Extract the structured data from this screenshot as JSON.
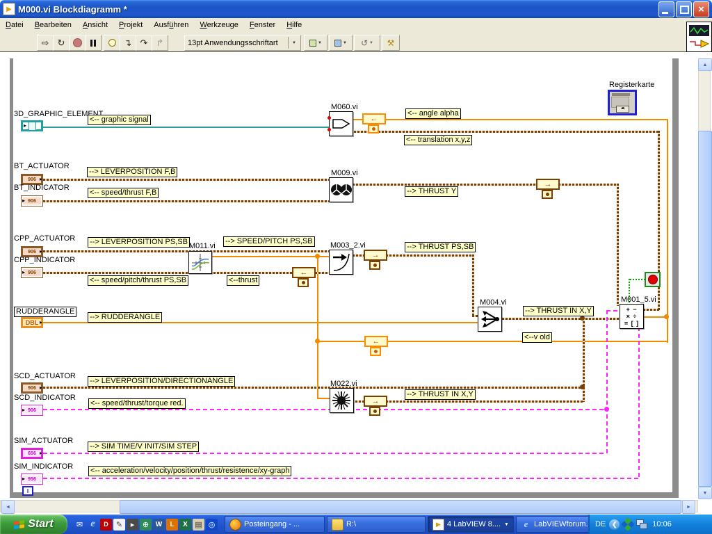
{
  "window": {
    "title": "M000.vi Blockdiagramm *",
    "close_glyph": "×"
  },
  "menu": {
    "items": [
      {
        "pre": "",
        "key": "D",
        "post": "atei"
      },
      {
        "pre": "",
        "key": "B",
        "post": "earbeiten"
      },
      {
        "pre": "",
        "key": "A",
        "post": "nsicht"
      },
      {
        "pre": "",
        "key": "P",
        "post": "rojekt"
      },
      {
        "pre": "Ausf",
        "key": "ü",
        "post": "hren"
      },
      {
        "pre": "",
        "key": "W",
        "post": "erkzeuge"
      },
      {
        "pre": "",
        "key": "F",
        "post": "enster"
      },
      {
        "pre": "",
        "key": "H",
        "post": "ilfe"
      }
    ]
  },
  "toolbar": {
    "font_selector": "13pt Anwendungsschriftart",
    "icons": {
      "run": "⇨",
      "run_continuous": "↻",
      "step_into": "↴",
      "step_over": "↷",
      "step_out": "↱",
      "dropdown": "▼",
      "help": "?"
    }
  },
  "diagram": {
    "terminals": {
      "g3d": {
        "name": "3D_GRAPHIC_ELEMENT"
      },
      "bt_actuator": {
        "name": "BT_ACTUATOR",
        "glyph": "906"
      },
      "bt_indicator": {
        "name": "BT_INDICATOR",
        "glyph": "906"
      },
      "cpp_actuator": {
        "name": "CPP_ACTUATOR",
        "glyph": "906"
      },
      "cpp_indicator": {
        "name": "CPP_INDICATOR",
        "glyph": "906"
      },
      "rudderangle": {
        "name": "RUDDERANGLE",
        "glyph": "DBL"
      },
      "scd_actuator": {
        "name": "SCD_ACTUATOR",
        "glyph": "906"
      },
      "scd_indicator": {
        "name": "SCD_INDICATOR",
        "glyph": "906"
      },
      "sim_actuator": {
        "name": "SIM_ACTUATOR",
        "glyph": "656"
      },
      "sim_indicator": {
        "name": "SIM_INDICATOR",
        "glyph": "956"
      },
      "sim_indicator2": {
        "glyph": "I"
      },
      "registerkarte": {
        "name": "Registerkarte",
        "chip": "◂▸"
      }
    },
    "vis": {
      "m060": "M060.vi",
      "m009": "M009.vi",
      "m011": "M011.vi",
      "m003_2": "M003_2.vi",
      "m004": "M004.vi",
      "m022": "M022.vi",
      "m001_5": "M001_5.vi",
      "m001_rows": [
        "+ −",
        "× ÷",
        "= [ ]"
      ]
    },
    "wire_labels": {
      "graphic_signal": "<-- graphic signal",
      "angle_alpha": "<-- angle alpha",
      "translation": "<-- translation x,y,z",
      "lever_fb": "--> LEVERPOSITION F,B",
      "speed_thrust_fb": "<-- speed/thrust F,B",
      "thrust_y": "--> THRUST Y",
      "lever_pssb": "--> LEVERPOSITION PS,SB",
      "speed_pitch_pssb": "--> SPEED/PITCH PS,SB",
      "thrust_pssb": "--> THRUST PS,SB",
      "speed_pitch_thrust_pssb": "<-- speed/pitch/thrust PS,SB",
      "thrust_small": "<--thrust",
      "rudderangle": "--> RUDDERANGLE",
      "thrust_in_xy_1": "--> THRUST IN X,Y",
      "v_old": "<--v old",
      "lever_dir": "--> LEVERPOSITION/DIRECTIONANGLE",
      "speed_thrust_torque": "<-- speed/thrust/torque red.",
      "thrust_in_xy_2": "--> THRUST IN X,Y",
      "sim_time": "--> SIM TIME/V INIT/SIM STEP",
      "acceleration": "<-- acceleration/velocity/position/thrust/resistence/xy-graph"
    },
    "colors": {
      "wire_orange": "#f08a00",
      "wire_brown": "#7b3f00",
      "wire_magenta": "#ff22ff",
      "wire_teal": "#2e9b9b",
      "wire_green": "#00a800",
      "label_bg": "#ffffc9"
    }
  },
  "scrollbars": {
    "up": "▲",
    "down": "▼",
    "left": "◄",
    "right": "►"
  },
  "taskbar": {
    "start_label": "Start",
    "quicklaunch": [
      {
        "name": "mail",
        "glyph": "✉"
      },
      {
        "name": "internet-explorer",
        "glyph": "e"
      },
      {
        "name": "dwg-viewer",
        "glyph": "D"
      },
      {
        "name": "notes-editor",
        "glyph": "✎"
      },
      {
        "name": "media-player",
        "glyph": "▸"
      },
      {
        "name": "globe-app",
        "glyph": "⊕"
      },
      {
        "name": "word",
        "glyph": "W"
      },
      {
        "name": "organizer",
        "glyph": "L"
      },
      {
        "name": "spreadsheet",
        "glyph": "X"
      },
      {
        "name": "fax-printer",
        "glyph": "▤"
      },
      {
        "name": "media-player-2",
        "glyph": "◎"
      }
    ],
    "tasks": [
      {
        "label": "Posteingang - ..."
      },
      {
        "label": "R:\\"
      },
      {
        "label": "4 LabVIEW 8...."
      },
      {
        "label": "LabVIEWforum..."
      }
    ],
    "tray": {
      "language": "DE",
      "time": "10:06"
    }
  }
}
